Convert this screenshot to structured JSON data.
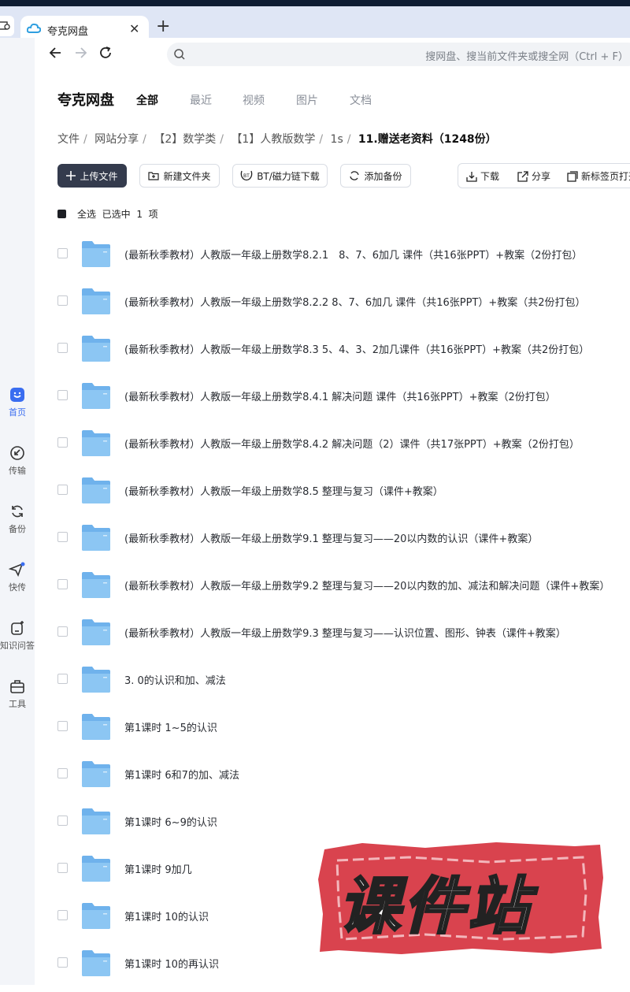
{
  "browser": {
    "tab_title": "夸克网盘",
    "tab_close": "✕",
    "new_tab": "+",
    "address_placeholder": "搜网盘、搜当前文件夹或搜全网（Ctrl + F）"
  },
  "sidebar": {
    "items": [
      {
        "label": "首页",
        "icon": "home-icon"
      },
      {
        "label": "传输",
        "icon": "transfer-icon"
      },
      {
        "label": "备份",
        "icon": "backup-icon"
      },
      {
        "label": "快传",
        "icon": "quick-send-icon"
      },
      {
        "label": "知识问答",
        "icon": "qa-icon"
      },
      {
        "label": "工具",
        "icon": "toolbox-icon"
      }
    ]
  },
  "header": {
    "brand": "夸克网盘",
    "tabs": [
      "全部",
      "最近",
      "视频",
      "图片",
      "文档"
    ]
  },
  "breadcrumb": [
    "文件",
    "网站分享",
    "【2】数学类",
    "【1】人教版数学",
    "1s",
    "11.赠送老资料（1248份）"
  ],
  "toolbar": {
    "upload": "上传文件",
    "new_folder": "新建文件夹",
    "bt_download": "BT/磁力链下载",
    "add_backup": "添加备份",
    "download": "下载",
    "share": "分享",
    "open_new_tab": "新标签页打开"
  },
  "selection": {
    "select_all": "全选",
    "selected_prefix": "已选中",
    "count": "1",
    "unit": "项"
  },
  "files": [
    "(最新秋季教材）人教版一年级上册数学8.2.1　8、7、6加几 课件（共16张PPT）+教案（2份打包）",
    "(最新秋季教材）人教版一年级上册数学8.2.2  8、7、6加几 课件（共16张PPT）+教案（共2份打包）",
    "(最新秋季教材）人教版一年级上册数学8.3  5、4、3、2加几课件（共16张PPT）+教案（共2份打包）",
    "(最新秋季教材）人教版一年级上册数学8.4.1  解决问题 课件（共16张PPT）+教案（2份打包）",
    "(最新秋季教材）人教版一年级上册数学8.4.2 解决问题（2）课件（共17张PPT）+教案（2份打包）",
    "(最新秋季教材）人教版一年级上册数学8.5 整理与复习（课件+教案）",
    "(最新秋季教材）人教版一年级上册数学9.1 整理与复习——20以内数的认识（课件+教案）",
    "(最新秋季教材）人教版一年级上册数学9.2 整理与复习——20以内数的加、减法和解决问题（课件+教案）",
    "(最新秋季教材）人教版一年级上册数学9.3 整理与复习——认识位置、图形、钟表（课件+教案）",
    "3. 0的认识和加、减法",
    "第1课时 1~5的认识",
    "第1课时 6和7的加、减法",
    "第1课时 6~9的认识",
    "第1课时 9加几",
    "第1课时 10的认识",
    "第1课时 10的再认识"
  ],
  "watermark": "课件站",
  "colors": {
    "accent": "#3a6df0",
    "folder": "#6fb2ec",
    "watermark_red": "#d9434e",
    "upload_bg": "#343b4d"
  }
}
